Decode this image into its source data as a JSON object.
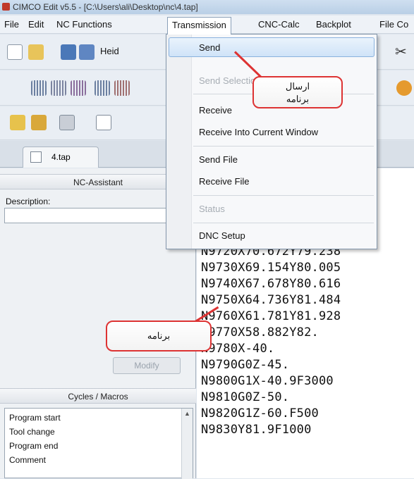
{
  "window": {
    "title": "CIMCO Edit v5.5 - [C:\\Users\\ali\\Desktop\\nc\\4.tap]"
  },
  "menubar": {
    "items": [
      {
        "key": "file",
        "label": "File"
      },
      {
        "key": "edit",
        "label": "Edit"
      },
      {
        "key": "nc",
        "label": "NC Functions"
      },
      {
        "key": "transmission",
        "label": "Transmission"
      },
      {
        "key": "cnccalc",
        "label": "CNC-Calc"
      },
      {
        "key": "backplot",
        "label": "Backplot"
      },
      {
        "key": "filecompare",
        "label": "File Co"
      }
    ]
  },
  "toolbar": {
    "heid_label": "Heid"
  },
  "tabs": {
    "file_tab": "4.tap"
  },
  "left_panel": {
    "nc_assistant_title": "NC-Assistant",
    "description_label": "Description:",
    "modify_label": "Modify",
    "cycles_title": "Cycles / Macros",
    "macros": [
      "Program start",
      "Tool change",
      "Program end",
      "Comment"
    ]
  },
  "transmission_menu": {
    "send": "Send",
    "send_selection": "Send Selection",
    "receive": "Receive",
    "receive_into_current": "Receive Into Current Window",
    "send_file": "Send File",
    "receive_file": "Receive File",
    "status": "Status",
    "dnc_setup": "DNC Setup"
  },
  "editor": {
    "lines": [
      "N9720X70.672Y79.238",
      "N9730X69.154Y80.005",
      "N9740X67.678Y80.616",
      "N9750X64.736Y81.484",
      "N9760X61.781Y81.928",
      "N9770X58.882Y82.",
      "N9780X-40.",
      "N9790G0Z-45.",
      "N9800G1X-40.9F3000",
      "N9810G0Z-50.",
      "N9820G1Z-60.F500",
      "N9830Y81.9F1000"
    ]
  },
  "callouts": {
    "send_program_line1": "ارسال",
    "send_program_line2": "برنامه",
    "program": "برنامه"
  },
  "colors": {
    "callout_border": "#dd3333",
    "menu_highlight": "#cfe3f8"
  }
}
